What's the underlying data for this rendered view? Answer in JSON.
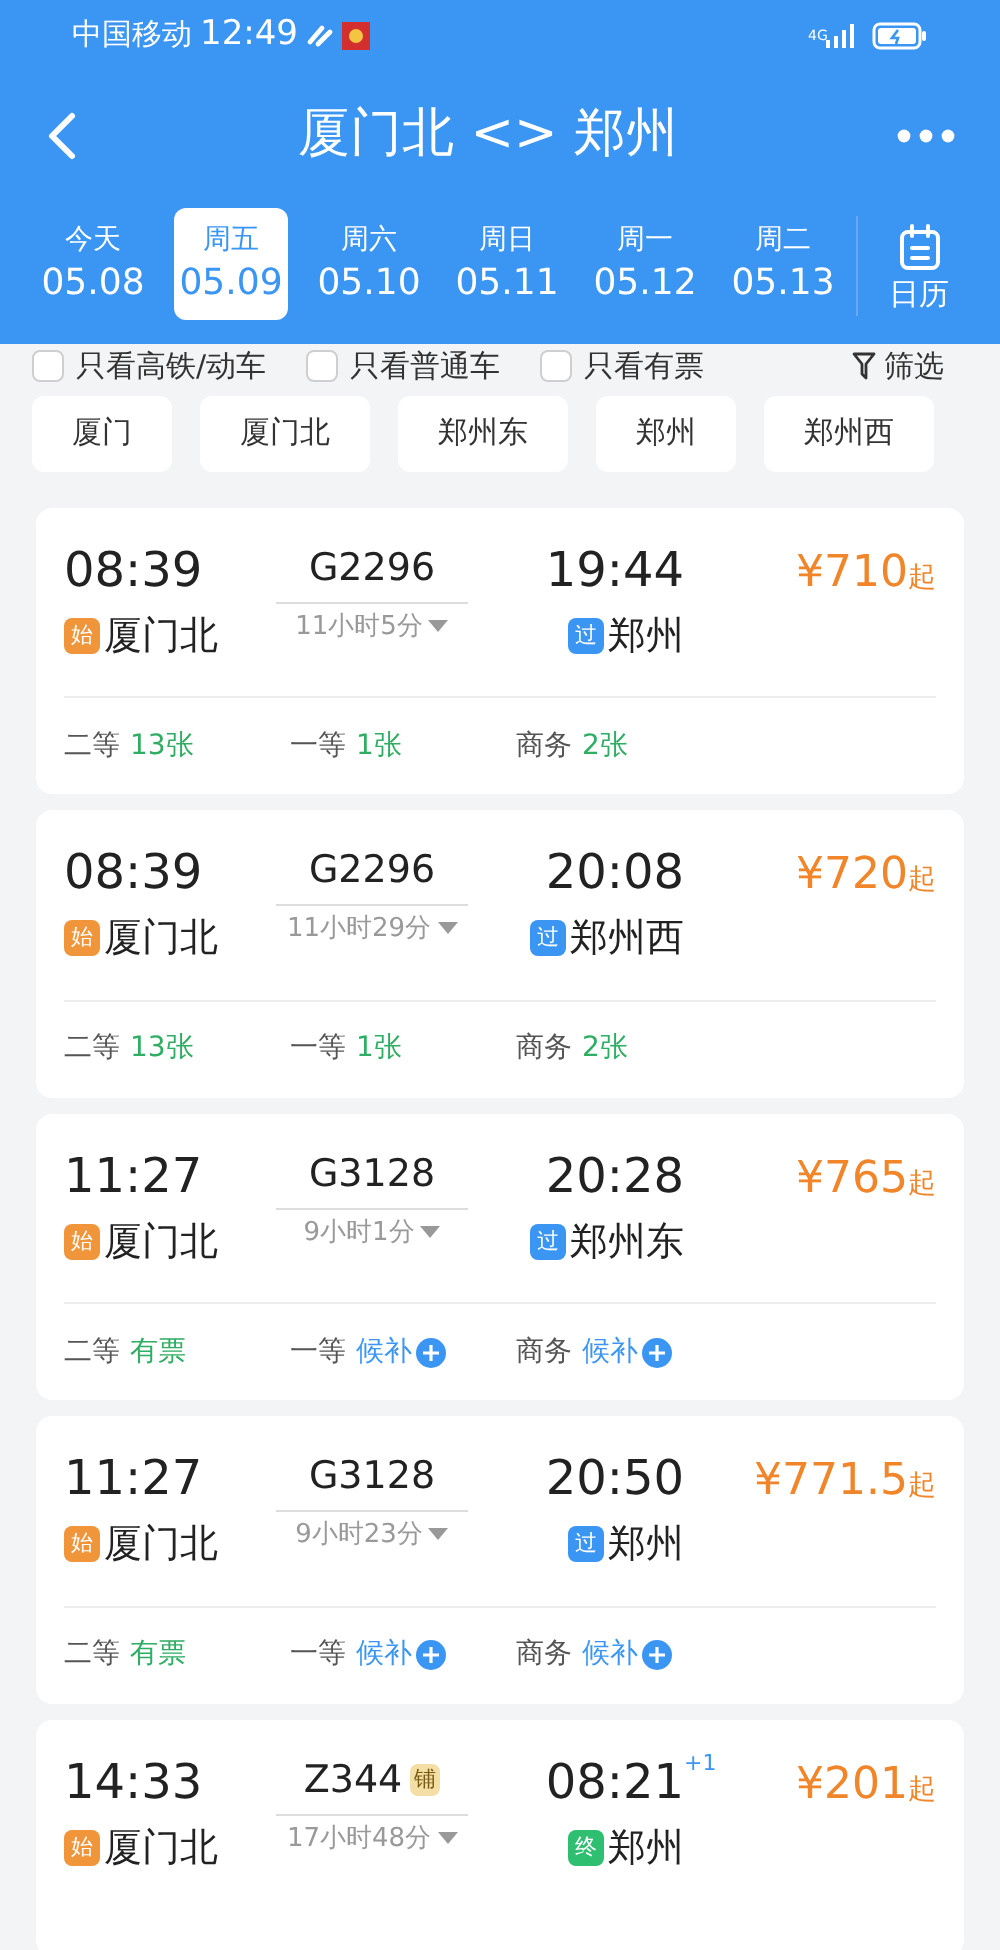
{
  "status_bar": {
    "carrier": "中国移动",
    "time": "12:49",
    "network": "4G"
  },
  "header": {
    "title": "厦门北 <> 郑州"
  },
  "dates": [
    {
      "weekday": "今天",
      "date": "05.08",
      "selected": false
    },
    {
      "weekday": "周五",
      "date": "05.09",
      "selected": true
    },
    {
      "weekday": "周六",
      "date": "05.10",
      "selected": false
    },
    {
      "weekday": "周日",
      "date": "05.11",
      "selected": false
    },
    {
      "weekday": "周一",
      "date": "05.12",
      "selected": false
    },
    {
      "weekday": "周二",
      "date": "05.13",
      "selected": false
    }
  ],
  "calendar_button": {
    "label": "日历"
  },
  "filters": [
    {
      "label": "只看高铁/动车",
      "checked": false
    },
    {
      "label": "只看普通车",
      "checked": false
    },
    {
      "label": "只看有票",
      "checked": false
    }
  ],
  "filter_button": {
    "label": "筛选"
  },
  "stations": [
    "厦门",
    "厦门北",
    "郑州东",
    "郑州",
    "郑州西"
  ],
  "trains": [
    {
      "depart": "08:39",
      "train": "G2296",
      "duration": "11小时5分",
      "arrive": "19:44",
      "from_badge": {
        "text": "始",
        "kind": "start"
      },
      "from": "厦门北",
      "to_badge": {
        "text": "过",
        "kind": "pass"
      },
      "to": "郑州",
      "price": "¥710",
      "price_suffix": "起",
      "seats": [
        {
          "class": "二等",
          "avail": "13张",
          "kind": "count"
        },
        {
          "class": "一等",
          "avail": "1张",
          "kind": "count"
        },
        {
          "class": "商务",
          "avail": "2张",
          "kind": "count"
        }
      ]
    },
    {
      "depart": "08:39",
      "train": "G2296",
      "duration": "11小时29分",
      "arrive": "20:08",
      "from_badge": {
        "text": "始",
        "kind": "start"
      },
      "from": "厦门北",
      "to_badge": {
        "text": "过",
        "kind": "pass"
      },
      "to": "郑州西",
      "price": "¥720",
      "price_suffix": "起",
      "seats": [
        {
          "class": "二等",
          "avail": "13张",
          "kind": "count"
        },
        {
          "class": "一等",
          "avail": "1张",
          "kind": "count"
        },
        {
          "class": "商务",
          "avail": "2张",
          "kind": "count"
        }
      ]
    },
    {
      "depart": "11:27",
      "train": "G3128",
      "duration": "9小时1分",
      "arrive": "20:28",
      "from_badge": {
        "text": "始",
        "kind": "start"
      },
      "from": "厦门北",
      "to_badge": {
        "text": "过",
        "kind": "pass"
      },
      "to": "郑州东",
      "price": "¥765",
      "price_suffix": "起",
      "seats": [
        {
          "class": "二等",
          "avail": "有票",
          "kind": "count"
        },
        {
          "class": "一等",
          "avail": "候补",
          "kind": "waitlist"
        },
        {
          "class": "商务",
          "avail": "候补",
          "kind": "waitlist"
        }
      ]
    },
    {
      "depart": "11:27",
      "train": "G3128",
      "duration": "9小时23分",
      "arrive": "20:50",
      "from_badge": {
        "text": "始",
        "kind": "start"
      },
      "from": "厦门北",
      "to_badge": {
        "text": "过",
        "kind": "pass"
      },
      "to": "郑州",
      "price": "¥771.5",
      "price_suffix": "起",
      "seats": [
        {
          "class": "二等",
          "avail": "有票",
          "kind": "count"
        },
        {
          "class": "一等",
          "avail": "候补",
          "kind": "waitlist"
        },
        {
          "class": "商务",
          "avail": "候补",
          "kind": "waitlist"
        }
      ]
    },
    {
      "depart": "14:33",
      "train": "Z344",
      "train_tag": "铺",
      "duration": "17小时48分",
      "arrive": "08:21",
      "next_day": "+1",
      "from_badge": {
        "text": "始",
        "kind": "start"
      },
      "from": "厦门北",
      "to_badge": {
        "text": "终",
        "kind": "end"
      },
      "to": "郑州",
      "price": "¥201",
      "price_suffix": "起"
    }
  ]
}
